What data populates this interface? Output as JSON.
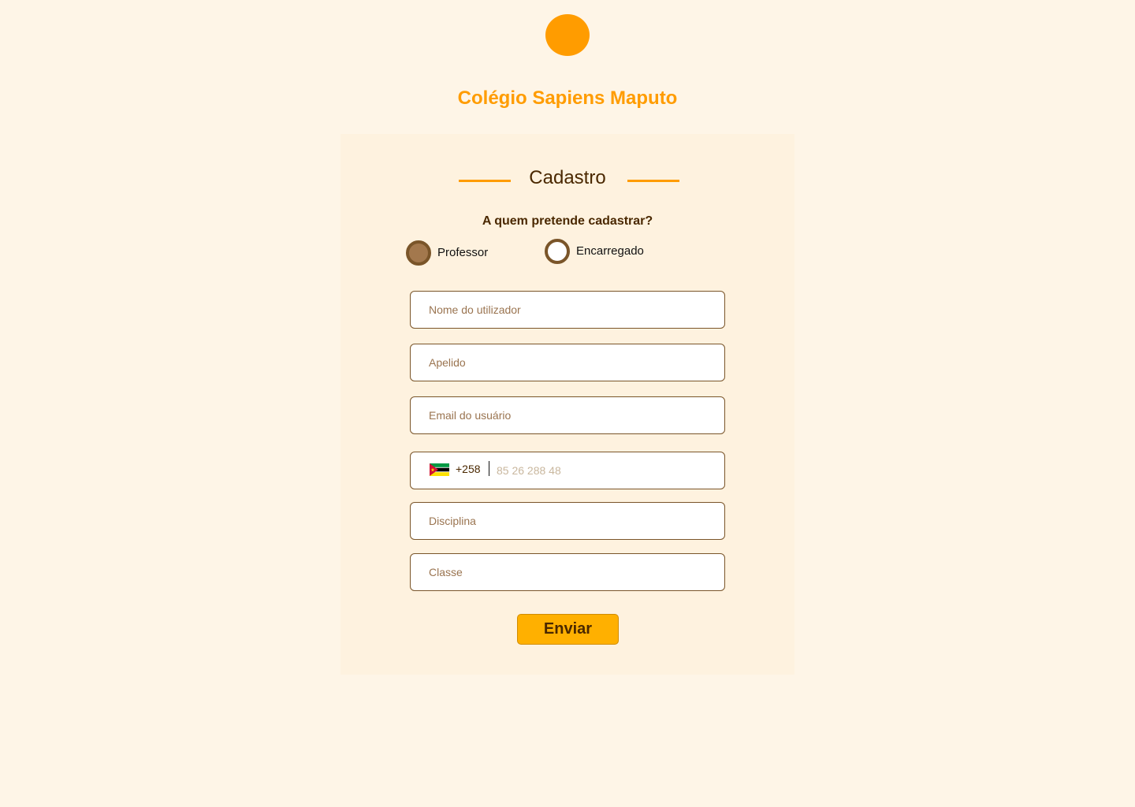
{
  "school": {
    "name": "Colégio Sapiens Maputo",
    "brand_color": "#FF9C00"
  },
  "form": {
    "title": "Cadastro",
    "question": "A quem pretende cadastrar?",
    "roles": [
      {
        "label": "Professor",
        "checked": true
      },
      {
        "label": "Encarregado",
        "checked": false
      }
    ],
    "fields": {
      "nome_placeholder": "Nome do utilizador",
      "apelido_placeholder": "Apelido",
      "email_placeholder": "Email do usuário",
      "phone": {
        "country_flag": "mozambique-flag-icon",
        "dial_code": "+258",
        "placeholder": "85 26 288 48"
      },
      "disciplina_placeholder": "Disciplina",
      "classe_placeholder": "Classe"
    },
    "submit_label": "Enviar"
  },
  "colors": {
    "background": "#FEF5E7",
    "card": "#FEF2DF",
    "text_dark": "#4A2800",
    "border": "#7A5529",
    "button": "#FFB000"
  }
}
